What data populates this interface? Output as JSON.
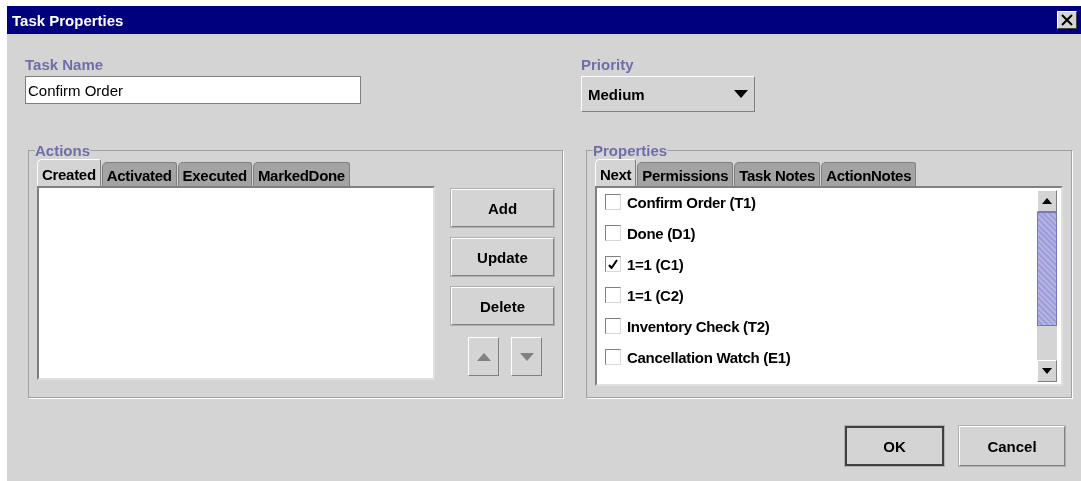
{
  "window": {
    "title": "Task Properties"
  },
  "task_name": {
    "label": "Task Name",
    "value": "Confirm Order"
  },
  "priority": {
    "label": "Priority",
    "value": "Medium"
  },
  "actions": {
    "title": "Actions",
    "tabs": [
      {
        "label": "Created",
        "selected": true
      },
      {
        "label": "Activated",
        "selected": false
      },
      {
        "label": "Executed",
        "selected": false
      },
      {
        "label": "MarkedDone",
        "selected": false
      }
    ],
    "buttons": [
      "Add",
      "Update",
      "Delete"
    ]
  },
  "properties": {
    "title": "Properties",
    "tabs": [
      {
        "label": "Next",
        "selected": true
      },
      {
        "label": "Permissions",
        "selected": false
      },
      {
        "label": "Task Notes",
        "selected": false
      },
      {
        "label": "ActionNotes",
        "selected": false
      }
    ],
    "items": [
      {
        "label": "Confirm Order (T1)",
        "checked": false
      },
      {
        "label": "Done (D1)",
        "checked": false
      },
      {
        "label": "1=1 (C1)",
        "checked": true
      },
      {
        "label": "1=1 (C2)",
        "checked": false
      },
      {
        "label": "Inventory Check (T2)",
        "checked": false
      },
      {
        "label": "Cancellation Watch (E1)",
        "checked": false
      }
    ]
  },
  "buttons": [
    "OK",
    "Cancel"
  ]
}
